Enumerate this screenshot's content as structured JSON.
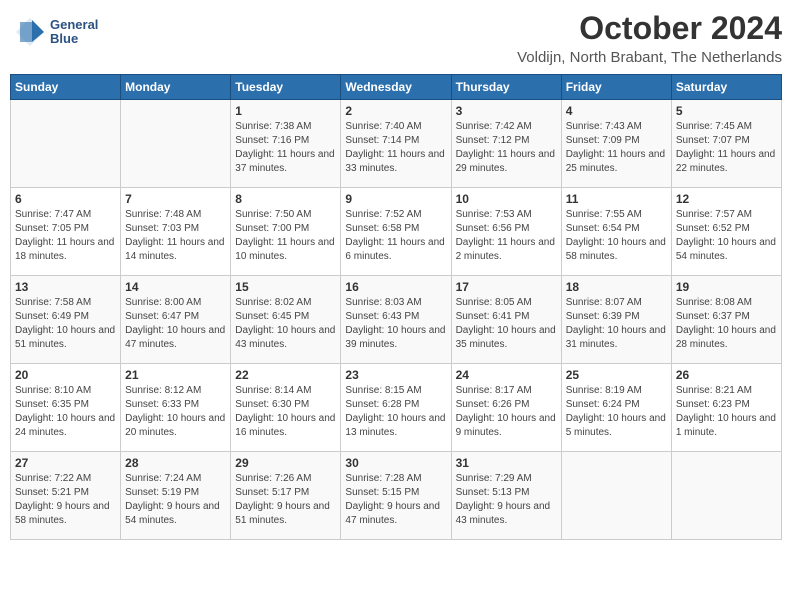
{
  "header": {
    "logo_line1": "General",
    "logo_line2": "Blue",
    "month": "October 2024",
    "location": "Voldijn, North Brabant, The Netherlands"
  },
  "days_of_week": [
    "Sunday",
    "Monday",
    "Tuesday",
    "Wednesday",
    "Thursday",
    "Friday",
    "Saturday"
  ],
  "weeks": [
    [
      {
        "day": "",
        "text": ""
      },
      {
        "day": "",
        "text": ""
      },
      {
        "day": "1",
        "text": "Sunrise: 7:38 AM\nSunset: 7:16 PM\nDaylight: 11 hours and 37 minutes."
      },
      {
        "day": "2",
        "text": "Sunrise: 7:40 AM\nSunset: 7:14 PM\nDaylight: 11 hours and 33 minutes."
      },
      {
        "day": "3",
        "text": "Sunrise: 7:42 AM\nSunset: 7:12 PM\nDaylight: 11 hours and 29 minutes."
      },
      {
        "day": "4",
        "text": "Sunrise: 7:43 AM\nSunset: 7:09 PM\nDaylight: 11 hours and 25 minutes."
      },
      {
        "day": "5",
        "text": "Sunrise: 7:45 AM\nSunset: 7:07 PM\nDaylight: 11 hours and 22 minutes."
      }
    ],
    [
      {
        "day": "6",
        "text": "Sunrise: 7:47 AM\nSunset: 7:05 PM\nDaylight: 11 hours and 18 minutes."
      },
      {
        "day": "7",
        "text": "Sunrise: 7:48 AM\nSunset: 7:03 PM\nDaylight: 11 hours and 14 minutes."
      },
      {
        "day": "8",
        "text": "Sunrise: 7:50 AM\nSunset: 7:00 PM\nDaylight: 11 hours and 10 minutes."
      },
      {
        "day": "9",
        "text": "Sunrise: 7:52 AM\nSunset: 6:58 PM\nDaylight: 11 hours and 6 minutes."
      },
      {
        "day": "10",
        "text": "Sunrise: 7:53 AM\nSunset: 6:56 PM\nDaylight: 11 hours and 2 minutes."
      },
      {
        "day": "11",
        "text": "Sunrise: 7:55 AM\nSunset: 6:54 PM\nDaylight: 10 hours and 58 minutes."
      },
      {
        "day": "12",
        "text": "Sunrise: 7:57 AM\nSunset: 6:52 PM\nDaylight: 10 hours and 54 minutes."
      }
    ],
    [
      {
        "day": "13",
        "text": "Sunrise: 7:58 AM\nSunset: 6:49 PM\nDaylight: 10 hours and 51 minutes."
      },
      {
        "day": "14",
        "text": "Sunrise: 8:00 AM\nSunset: 6:47 PM\nDaylight: 10 hours and 47 minutes."
      },
      {
        "day": "15",
        "text": "Sunrise: 8:02 AM\nSunset: 6:45 PM\nDaylight: 10 hours and 43 minutes."
      },
      {
        "day": "16",
        "text": "Sunrise: 8:03 AM\nSunset: 6:43 PM\nDaylight: 10 hours and 39 minutes."
      },
      {
        "day": "17",
        "text": "Sunrise: 8:05 AM\nSunset: 6:41 PM\nDaylight: 10 hours and 35 minutes."
      },
      {
        "day": "18",
        "text": "Sunrise: 8:07 AM\nSunset: 6:39 PM\nDaylight: 10 hours and 31 minutes."
      },
      {
        "day": "19",
        "text": "Sunrise: 8:08 AM\nSunset: 6:37 PM\nDaylight: 10 hours and 28 minutes."
      }
    ],
    [
      {
        "day": "20",
        "text": "Sunrise: 8:10 AM\nSunset: 6:35 PM\nDaylight: 10 hours and 24 minutes."
      },
      {
        "day": "21",
        "text": "Sunrise: 8:12 AM\nSunset: 6:33 PM\nDaylight: 10 hours and 20 minutes."
      },
      {
        "day": "22",
        "text": "Sunrise: 8:14 AM\nSunset: 6:30 PM\nDaylight: 10 hours and 16 minutes."
      },
      {
        "day": "23",
        "text": "Sunrise: 8:15 AM\nSunset: 6:28 PM\nDaylight: 10 hours and 13 minutes."
      },
      {
        "day": "24",
        "text": "Sunrise: 8:17 AM\nSunset: 6:26 PM\nDaylight: 10 hours and 9 minutes."
      },
      {
        "day": "25",
        "text": "Sunrise: 8:19 AM\nSunset: 6:24 PM\nDaylight: 10 hours and 5 minutes."
      },
      {
        "day": "26",
        "text": "Sunrise: 8:21 AM\nSunset: 6:23 PM\nDaylight: 10 hours and 1 minute."
      }
    ],
    [
      {
        "day": "27",
        "text": "Sunrise: 7:22 AM\nSunset: 5:21 PM\nDaylight: 9 hours and 58 minutes."
      },
      {
        "day": "28",
        "text": "Sunrise: 7:24 AM\nSunset: 5:19 PM\nDaylight: 9 hours and 54 minutes."
      },
      {
        "day": "29",
        "text": "Sunrise: 7:26 AM\nSunset: 5:17 PM\nDaylight: 9 hours and 51 minutes."
      },
      {
        "day": "30",
        "text": "Sunrise: 7:28 AM\nSunset: 5:15 PM\nDaylight: 9 hours and 47 minutes."
      },
      {
        "day": "31",
        "text": "Sunrise: 7:29 AM\nSunset: 5:13 PM\nDaylight: 9 hours and 43 minutes."
      },
      {
        "day": "",
        "text": ""
      },
      {
        "day": "",
        "text": ""
      }
    ]
  ]
}
